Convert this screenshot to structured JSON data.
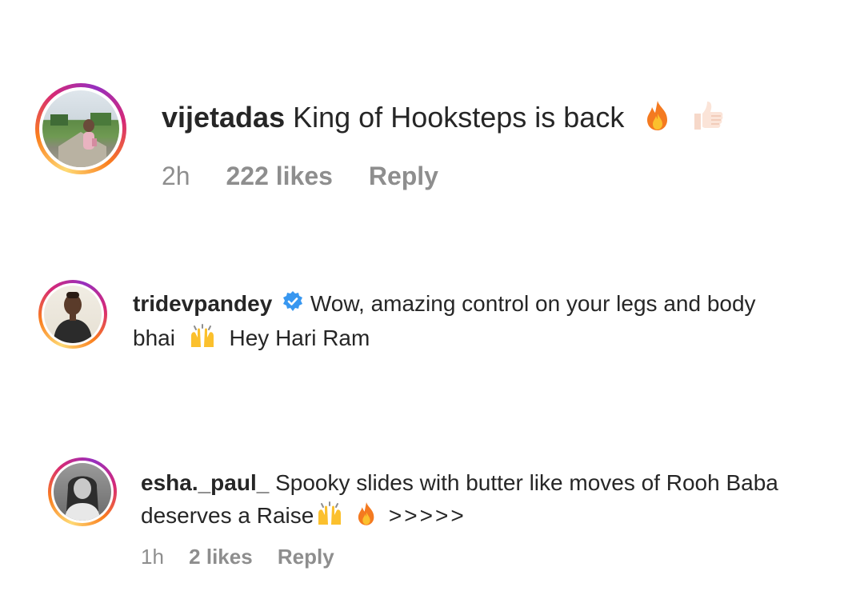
{
  "comments": [
    {
      "username": "vijetadas",
      "text": "King of Hooksteps is back",
      "emojis": [
        "fire-emoji",
        "thumbs-up-emoji"
      ],
      "time": "2h",
      "likes": "222 likes",
      "reply": "Reply"
    },
    {
      "username": "tridevpandey",
      "verified": true,
      "text_line1": "Wow, amazing control on your legs and body",
      "text_line2_a": "bhai",
      "text_line2_b": "Hey Hari Ram",
      "emojis": [
        "raising-hands-emoji"
      ]
    },
    {
      "username": "esha._paul_",
      "text_line1": "Spooky slides with butter like moves of Rooh Baba",
      "text_line2_a": "deserves a Raise",
      "text_line2_b": ">>>>>",
      "emojis": [
        "raising-hands-emoji",
        "fire-emoji"
      ],
      "time": "1h",
      "likes": "2 likes",
      "reply": "Reply"
    }
  ],
  "colors": {
    "text": "#262626",
    "meta": "#8e8e8e",
    "verified": "#3897f0"
  }
}
